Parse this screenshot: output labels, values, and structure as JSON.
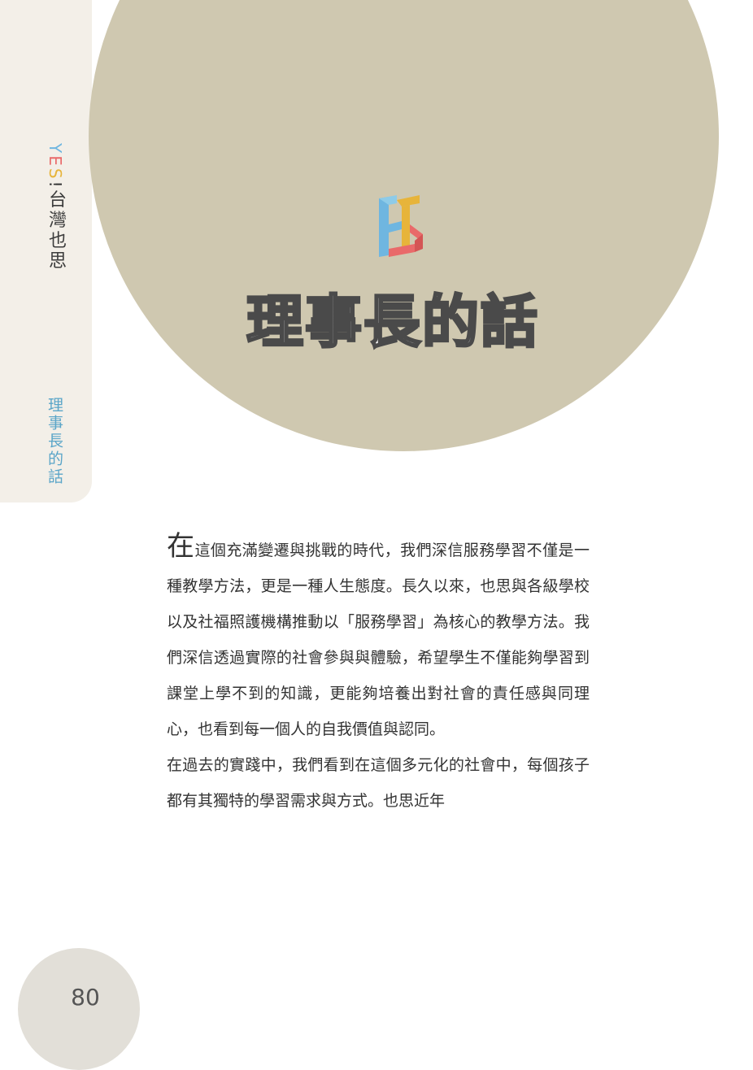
{
  "sidebar": {
    "brand_y": "Y",
    "brand_e": "E",
    "brand_s": "S",
    "brand_bang": "!",
    "series_title": "台灣也思",
    "section_label": "理事長的話"
  },
  "heading": {
    "title": "理事長的話",
    "logo_icon": "ys-logo-icon"
  },
  "article": {
    "drop_cap": "在",
    "paragraph1_rest": "這個充滿變遷與挑戰的時代，我們深信服務學習不僅是一種教學方法，更是一種人生態度。長久以來，也思與各級學校以及社福照護機構推動以「服務學習」為核心的教學方法。我們深信透過實際的社會參與與體驗，希望學生不僅能夠學習到課堂上學不到的知識，更能夠培養出對社會的責任感與同理心，也看到每一個人的自我價值與認同。",
    "paragraph2": "在過去的實踐中，我們看到在這個多元化的社會中，每個孩子都有其獨特的學習需求與方式。也思近年"
  },
  "footer": {
    "page_number": "80"
  },
  "colors": {
    "circle": "#cfc8b0",
    "sidebar_bg": "#f3efe8",
    "accent_blue": "#5aa5c8",
    "accent_red": "#e96a6a",
    "accent_yellow": "#e7b43a"
  }
}
